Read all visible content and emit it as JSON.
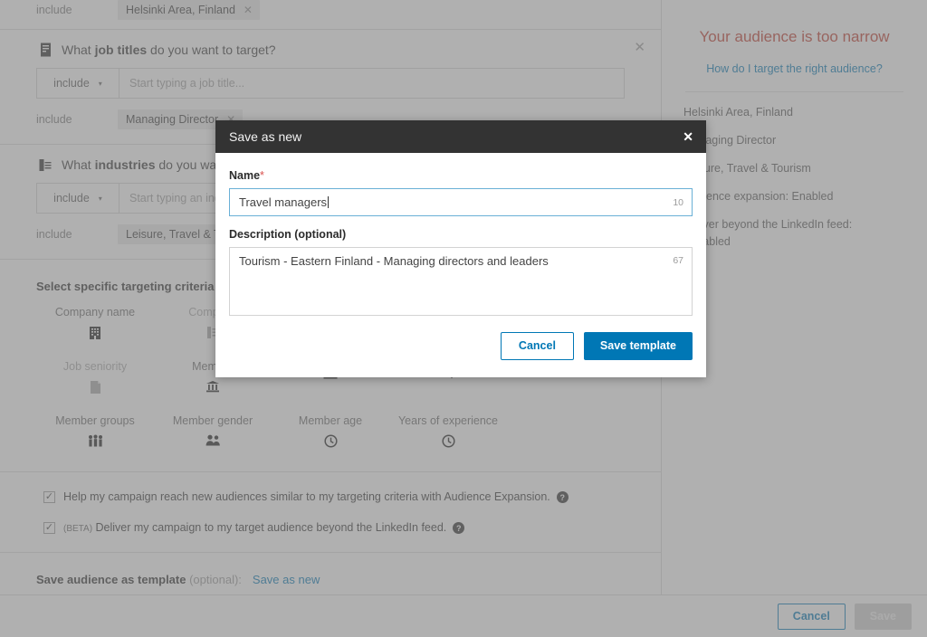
{
  "page": {
    "location_row": {
      "include_label": "include",
      "chip": "Helsinki Area, Finland",
      "chip_remove": "✕"
    },
    "job_titles": {
      "icon": "document-person-icon",
      "question_pre": "What ",
      "question_bold": "job titles",
      "question_post": " do you want to target?",
      "close": "✕",
      "select_value": "include",
      "caret": "▾",
      "placeholder": "Start typing a job title...",
      "chip_include_label": "include",
      "chip": "Managing Director",
      "chip_remove": "✕"
    },
    "industries": {
      "icon": "building-icon",
      "question_pre": "What ",
      "question_bold": "industries",
      "question_post": " do you want to",
      "select_value": "include",
      "caret": "▾",
      "placeholder": "Start typing an indu",
      "chip_include_label": "include",
      "chip": "Leisure, Travel & Tou"
    },
    "criteria": {
      "title": "Select specific targeting criteria to",
      "cells": [
        {
          "label": "Company name",
          "icon": "company-building-icon",
          "dim": false
        },
        {
          "label": "Company",
          "icon": "company-list-icon",
          "dim": true
        },
        {
          "label": "",
          "icon": "",
          "dim": false
        },
        {
          "label": "",
          "icon": "",
          "dim": false
        },
        {
          "label": "",
          "icon": "",
          "dim": false
        },
        {
          "label": "Job seniority",
          "icon": "badge-icon",
          "dim": true
        },
        {
          "label": "Member",
          "icon": "school-icon",
          "dim": false
        },
        {
          "label": "",
          "icon": "briefcase-icon",
          "dim": false
        },
        {
          "label": "",
          "icon": "degree-icon",
          "dim": false
        },
        {
          "label": "",
          "icon": "skills-icon",
          "dim": false
        },
        {
          "label": "Member groups",
          "icon": "group-people-icon",
          "dim": false
        },
        {
          "label": "Member gender",
          "icon": "two-people-icon",
          "dim": false
        },
        {
          "label": "Member age",
          "icon": "clock-icon",
          "dim": false
        },
        {
          "label": "Years of experience",
          "icon": "clock-icon",
          "dim": false
        },
        {
          "label": "",
          "icon": "",
          "dim": false
        }
      ]
    },
    "checkboxes": [
      {
        "checked": "✓",
        "beta": "",
        "text": "Help my campaign reach new audiences similar to my targeting criteria with Audience Expansion.",
        "help": "?"
      },
      {
        "checked": "✓",
        "beta": "(BETA)",
        "text": " Deliver my campaign to my target audience beyond the LinkedIn feed.",
        "help": "?"
      }
    ],
    "save_template_bar": {
      "label": "Save audience as template",
      "optional": " (optional):",
      "link": "Save as new"
    },
    "footer": {
      "cancel": "Cancel",
      "save": "Save"
    }
  },
  "right_rail": {
    "title": "Your audience is too narrow",
    "help_link": "How do I target the right audience?",
    "items": [
      "Helsinki Area, Finland",
      "Managing Director",
      "Leisure, Travel & Tourism",
      "Audience expansion:  Enabled"
    ],
    "last_item_line1": "Deliver beyond the LinkedIn feed:",
    "last_item_line2": "Enabled"
  },
  "modal": {
    "title": "Save as new",
    "close": "✕",
    "name": {
      "label": "Name",
      "required_mark": "*",
      "value": "Travel managers",
      "count": "10"
    },
    "description": {
      "label": "Description (optional)",
      "value": "Tourism - Eastern Finland - Managing directors and leaders",
      "count": "67"
    },
    "cancel": "Cancel",
    "save": "Save template"
  },
  "colors": {
    "accent_blue": "#0077b5",
    "warning_red": "#c0392b",
    "modal_header": "#333333",
    "focus_border": "#6ab0d6"
  }
}
